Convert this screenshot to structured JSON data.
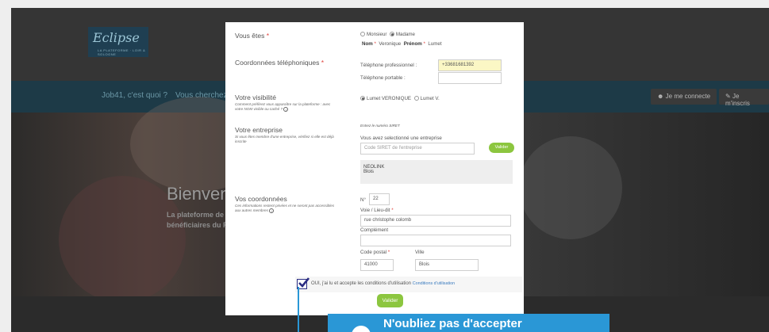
{
  "site": {
    "logo_text": "Eclipse",
    "logo_sub": "LA PLATEFORME · LOIR & SOLOGNE",
    "nav_items": [
      "Job41, c'est quoi ?",
      "Vous cherchez un"
    ],
    "connect_label": "Je me connecte",
    "signup_label": "Je m'inscris",
    "hero_title": "Bienven",
    "hero_line1": "La plateforme de m",
    "hero_line2": "bénéficiaires du R"
  },
  "form": {
    "civility": {
      "label": "Vous êtes",
      "options": [
        "Monsieur",
        "Madame"
      ],
      "selected": "Madame",
      "nom_label": "Nom",
      "nom_value": "Veronique",
      "prenom_label": "Prénom",
      "prenom_value": "Lumet"
    },
    "phones": {
      "label": "Coordonnées téléphoniques",
      "pro_label": "Téléphone professionnel :",
      "pro_value": "+33681681392",
      "mobile_label": "Téléphone portable :",
      "mobile_value": ""
    },
    "visibility": {
      "label": "Votre visibilité",
      "help": "Comment préférez vous apparaître sur la plateforme : avec votre NOM visible ou caché ?",
      "options": [
        "Lumet VERONIQUE",
        "Lumet V."
      ],
      "selected": "Lumet VERONIQUE"
    },
    "company": {
      "label": "Votre entreprise",
      "help": "Si vous êtes membre d'une entreprise, vérifiez si elle est déjà inscrite",
      "siret_hint": "Entrez le numéro SIRET",
      "selected_text": "Vous avez selectionné une entreprise",
      "siret_placeholder": "Code SIRET de l'entreprise",
      "validate_label": "Valider",
      "name": "NEOLINK",
      "city": "Blois"
    },
    "address": {
      "label": "Vos coordonnées",
      "help": "Ces informations restent privées et ne seront pas accessibles aux autres membres",
      "no_label": "N°",
      "no_value": "22",
      "street_label": "Voie / Lieu-dit",
      "street_value": "rue christophe colomb",
      "complement_label": "Complément",
      "complement_value": "",
      "postal_label": "Code postal",
      "postal_value": "41000",
      "city_label": "Ville",
      "city_value": "Blois"
    },
    "terms": {
      "text": "OUI, j'ai lu et accepte les conditions d'utilisation",
      "link": "Conditions d'utilisation",
      "checked": true
    },
    "submit_label": "Valider"
  },
  "tooltip": {
    "text": "N'oubliez pas d'accepter",
    "color": "#2a97d6"
  },
  "colors": {
    "required": "#e0403a",
    "button": "#8cc63f",
    "highlight_field": "#fbf7c5"
  }
}
